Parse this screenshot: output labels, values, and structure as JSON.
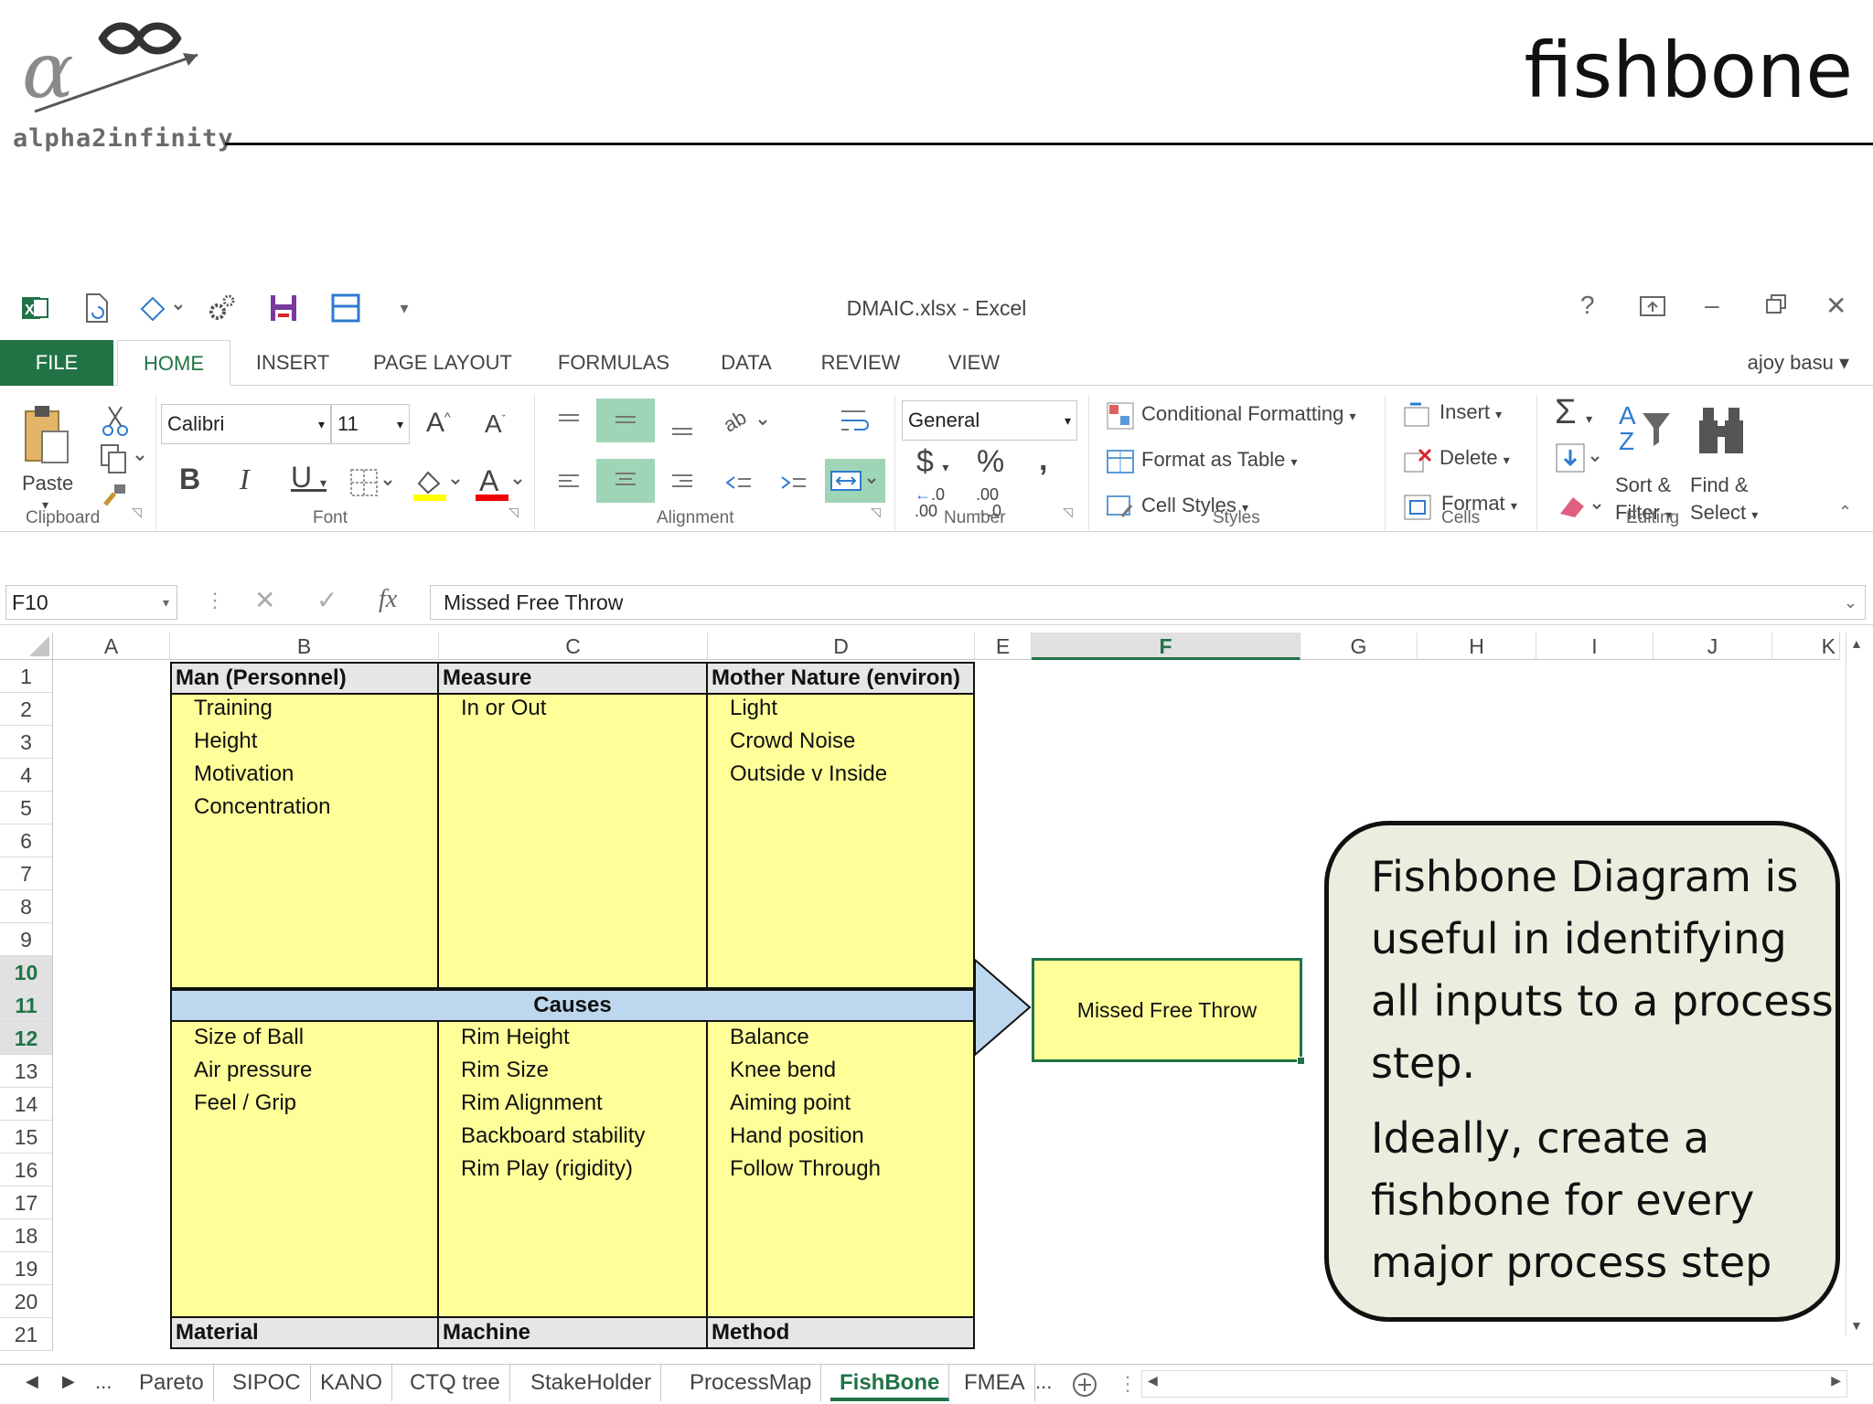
{
  "slide": {
    "logo_text": "alpha2infinity",
    "title": "fishbone",
    "callout_lines": [
      "Fishbone Diagram is useful in identifying all inputs to a process step.",
      "Ideally, create a fishbone for every major process step"
    ]
  },
  "window": {
    "title": "DMAIC.xlsx - Excel",
    "user": "ajoy basu"
  },
  "ribbon_tabs": [
    "FILE",
    "HOME",
    "INSERT",
    "PAGE LAYOUT",
    "FORMULAS",
    "DATA",
    "REVIEW",
    "VIEW"
  ],
  "active_tab": "HOME",
  "ribbon": {
    "paste": "Paste",
    "font_name": "Calibri",
    "font_size": "11",
    "number_format": "General",
    "conditional_formatting": "Conditional Formatting",
    "format_as_table": "Format as Table",
    "cell_styles": "Cell Styles",
    "insert": "Insert",
    "delete": "Delete",
    "format": "Format",
    "sort_filter": [
      "Sort &",
      "Filter"
    ],
    "find_select": [
      "Find &",
      "Select"
    ],
    "groups": [
      "Clipboard",
      "Font",
      "Alignment",
      "Number",
      "Styles",
      "Cells",
      "Editing"
    ]
  },
  "formula_bar": {
    "name_box": "F10",
    "fx": "fx",
    "value": "Missed Free Throw"
  },
  "columns": [
    "A",
    "B",
    "C",
    "D",
    "E",
    "F",
    "G",
    "H",
    "I",
    "J",
    "K"
  ],
  "selected_column": "F",
  "rows": [
    "1",
    "2",
    "3",
    "4",
    "5",
    "6",
    "7",
    "8",
    "9",
    "10",
    "11",
    "12",
    "13",
    "14",
    "15",
    "16",
    "17",
    "18",
    "19",
    "20",
    "21"
  ],
  "selected_rows": [
    "10",
    "11",
    "12"
  ],
  "fishbone": {
    "top_headers": [
      "Man (Personnel)",
      "Measure",
      "Mother Nature (environ)"
    ],
    "top_causes": [
      [
        "Training",
        "Height",
        "Motivation",
        "Concentration"
      ],
      [
        "In or Out"
      ],
      [
        "Light",
        "Crowd Noise",
        "Outside v Inside"
      ]
    ],
    "spine_label": "Causes",
    "effect": "Missed Free Throw",
    "bottom_causes": [
      [
        "Size of Ball",
        "Air pressure",
        "Feel / Grip"
      ],
      [
        "Rim Height",
        "Rim Size",
        "Rim Alignment",
        "Backboard stability",
        "Rim Play (rigidity)"
      ],
      [
        "Balance",
        "Knee bend",
        "Aiming point",
        "Hand position",
        "Follow Through"
      ]
    ],
    "bottom_headers": [
      "Material",
      "Machine",
      "Method"
    ]
  },
  "sheet_tabs": [
    "Pareto",
    "SIPOC",
    "KANO",
    "CTQ tree",
    "StakeHolder",
    "ProcessMap",
    "FishBone",
    "FMEA"
  ],
  "active_sheet": "FishBone",
  "colors": {
    "excel_green": "#217346",
    "cell_yellow": "#ffff99",
    "spine_blue": "#bdd7ee",
    "callout_bg": "#ededdf"
  }
}
